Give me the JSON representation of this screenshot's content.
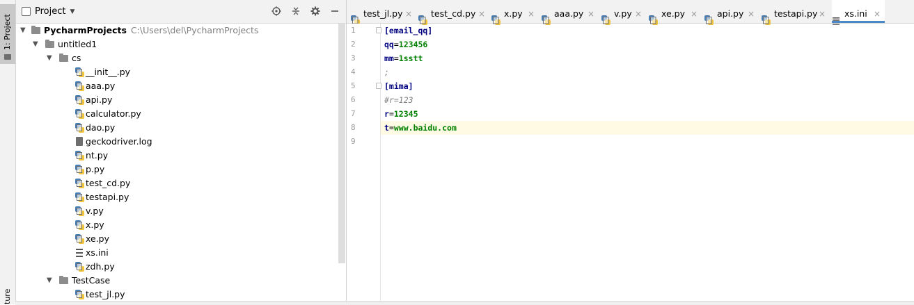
{
  "sidebar_strip": {
    "project_label": "1: Project",
    "structure_label": "ture"
  },
  "project_panel": {
    "title": "Project",
    "tools": [
      "locate-icon",
      "collapse-icon",
      "gear-icon",
      "minimize-icon"
    ],
    "tree": [
      {
        "label": "PycharmProjects",
        "path": "C:\\Users\\del\\PycharmProjects",
        "type": "folder",
        "depth": 0,
        "expanded": true,
        "bold": true
      },
      {
        "label": "untitled1",
        "type": "folder",
        "depth": 1,
        "expanded": true
      },
      {
        "label": "cs",
        "type": "folder",
        "depth": 2,
        "expanded": true
      },
      {
        "label": "__init__.py",
        "type": "py",
        "depth": 3
      },
      {
        "label": "aaa.py",
        "type": "py",
        "depth": 3
      },
      {
        "label": "api.py",
        "type": "py",
        "depth": 3
      },
      {
        "label": "calculator.py",
        "type": "py",
        "depth": 3
      },
      {
        "label": "dao.py",
        "type": "py",
        "depth": 3
      },
      {
        "label": "geckodriver.log",
        "type": "log",
        "depth": 3
      },
      {
        "label": "nt.py",
        "type": "py",
        "depth": 3
      },
      {
        "label": "p.py",
        "type": "py",
        "depth": 3
      },
      {
        "label": "test_cd.py",
        "type": "py",
        "depth": 3
      },
      {
        "label": "testapi.py",
        "type": "py",
        "depth": 3
      },
      {
        "label": "v.py",
        "type": "py",
        "depth": 3
      },
      {
        "label": "x.py",
        "type": "py",
        "depth": 3
      },
      {
        "label": "xe.py",
        "type": "py",
        "depth": 3
      },
      {
        "label": "xs.ini",
        "type": "ini",
        "depth": 3
      },
      {
        "label": "zdh.py",
        "type": "py",
        "depth": 3
      },
      {
        "label": "TestCase",
        "type": "folder",
        "depth": 2,
        "expanded": true
      },
      {
        "label": "test_jl.py",
        "type": "py",
        "depth": 3
      }
    ]
  },
  "editor": {
    "tabs": [
      {
        "label": "test_jl.py",
        "type": "py",
        "active": false
      },
      {
        "label": "test_cd.py",
        "type": "py",
        "active": false
      },
      {
        "label": "x.py",
        "type": "py",
        "active": false
      },
      {
        "label": "aaa.py",
        "type": "py",
        "active": false
      },
      {
        "label": "v.py",
        "type": "py",
        "active": false
      },
      {
        "label": "xe.py",
        "type": "py",
        "active": false
      },
      {
        "label": "api.py",
        "type": "py",
        "active": false
      },
      {
        "label": "testapi.py",
        "type": "py",
        "active": false
      },
      {
        "label": "xs.ini",
        "type": "ini",
        "active": true
      }
    ],
    "close_glyph": "×",
    "current_line": 8,
    "lines": [
      {
        "n": "1",
        "kind": "section",
        "text": "[email_qq]"
      },
      {
        "n": "2",
        "kind": "kv",
        "key": "qq",
        "eq": "=",
        "val": "123456"
      },
      {
        "n": "3",
        "kind": "kv",
        "key": "mm",
        "eq": "=",
        "val": "1sstt"
      },
      {
        "n": "4",
        "kind": "comment",
        "text": ";"
      },
      {
        "n": "5",
        "kind": "section",
        "text": "[mima]"
      },
      {
        "n": "6",
        "kind": "comment",
        "text": "#r=123"
      },
      {
        "n": "7",
        "kind": "kv",
        "key": "r",
        "eq": "=",
        "val": "12345"
      },
      {
        "n": "8",
        "kind": "kv",
        "key": "t",
        "eq": "=",
        "val": "www.baidu.com"
      },
      {
        "n": "9",
        "kind": "empty",
        "text": ""
      }
    ]
  },
  "colors": {
    "section": "#000080",
    "value": "#008000",
    "comment": "#808080",
    "accent": "#4a88c7",
    "current_line_bg": "#fffae3"
  }
}
